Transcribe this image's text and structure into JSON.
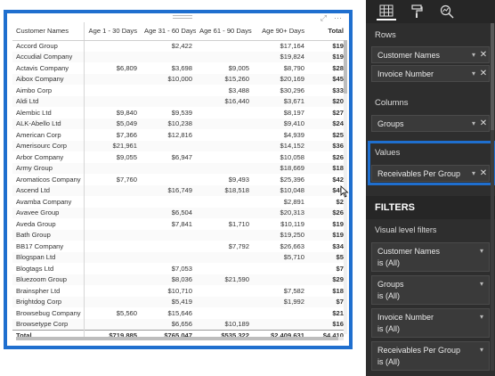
{
  "matrix": {
    "columns": [
      "Customer Names",
      "Age 1 - 30 Days",
      "Age 31 - 60 Days",
      "Age 61 - 90 Days",
      "Age 90+ Days",
      "Total"
    ],
    "rows": [
      [
        "Accord Group",
        "",
        "$2,422",
        "",
        "$17,164",
        "$19"
      ],
      [
        "Accudial Company",
        "",
        "",
        "",
        "$19,824",
        "$19"
      ],
      [
        "Actavis Company",
        "$6,809",
        "$3,698",
        "$9,005",
        "$8,790",
        "$28"
      ],
      [
        "Aibox Company",
        "",
        "$10,000",
        "$15,260",
        "$20,169",
        "$45"
      ],
      [
        "Aimbo Corp",
        "",
        "",
        "$3,488",
        "$30,296",
        "$33"
      ],
      [
        "Aldi Ltd",
        "",
        "",
        "$16,440",
        "$3,671",
        "$20"
      ],
      [
        "Alembic Ltd",
        "$9,840",
        "$9,539",
        "",
        "$8,197",
        "$27"
      ],
      [
        "ALK-Abello Ltd",
        "$5,049",
        "$10,238",
        "",
        "$9,410",
        "$24"
      ],
      [
        "American Corp",
        "$7,366",
        "$12,816",
        "",
        "$4,939",
        "$25"
      ],
      [
        "Amerisourc Corp",
        "$21,961",
        "",
        "",
        "$14,152",
        "$36"
      ],
      [
        "Arbor Company",
        "$9,055",
        "$6,947",
        "",
        "$10,058",
        "$26"
      ],
      [
        "Army Group",
        "",
        "",
        "",
        "$18,669",
        "$18"
      ],
      [
        "Aromaticos Company",
        "$7,760",
        "",
        "$9,493",
        "$25,396",
        "$42"
      ],
      [
        "Ascend Ltd",
        "",
        "$16,749",
        "$18,518",
        "$10,048",
        "$45"
      ],
      [
        "Avamba Company",
        "",
        "",
        "",
        "$2,891",
        "$2"
      ],
      [
        "Avavee Group",
        "",
        "$6,504",
        "",
        "$20,313",
        "$26"
      ],
      [
        "Aveda Group",
        "",
        "$7,841",
        "$1,710",
        "$10,119",
        "$19"
      ],
      [
        "Bath Group",
        "",
        "",
        "",
        "$19,250",
        "$19"
      ],
      [
        "BB17 Company",
        "",
        "",
        "$7,792",
        "$26,663",
        "$34"
      ],
      [
        "Blogspan Ltd",
        "",
        "",
        "",
        "$5,710",
        "$5"
      ],
      [
        "Blogtags Ltd",
        "",
        "$7,053",
        "",
        "",
        "$7"
      ],
      [
        "Bluezoom Group",
        "",
        "$8,036",
        "$21,590",
        "",
        "$29"
      ],
      [
        "Brainspher Ltd",
        "",
        "$10,710",
        "",
        "$7,582",
        "$18"
      ],
      [
        "Brightdog Corp",
        "",
        "$5,419",
        "",
        "$1,992",
        "$7"
      ],
      [
        "Browsebug Company",
        "$5,560",
        "$15,646",
        "",
        "",
        "$21"
      ],
      [
        "Browsetype Corp",
        "",
        "$6,656",
        "$10,189",
        "",
        "$16"
      ]
    ],
    "totals": [
      "Total",
      "$719,885",
      "$765,047",
      "$535,322",
      "$2,409,631",
      "$4,410"
    ]
  },
  "fields_pane": {
    "rows_label": "Rows",
    "rows_items": [
      "Customer Names",
      "Invoice Number"
    ],
    "columns_label": "Columns",
    "columns_items": [
      "Groups"
    ],
    "values_label": "Values",
    "values_items": [
      "Receivables Per Group"
    ],
    "filters_title": "FILTERS",
    "visual_filters_label": "Visual level filters",
    "filters": [
      {
        "name": "Customer Names",
        "state": "is (All)"
      },
      {
        "name": "Groups",
        "state": "is (All)"
      },
      {
        "name": "Invoice Number",
        "state": "is (All)"
      },
      {
        "name": "Receivables Per Group",
        "state": "is (All)"
      }
    ]
  },
  "colors": {
    "highlight_border": "#1f6fcf",
    "pane_background": "#2e2e2e"
  }
}
